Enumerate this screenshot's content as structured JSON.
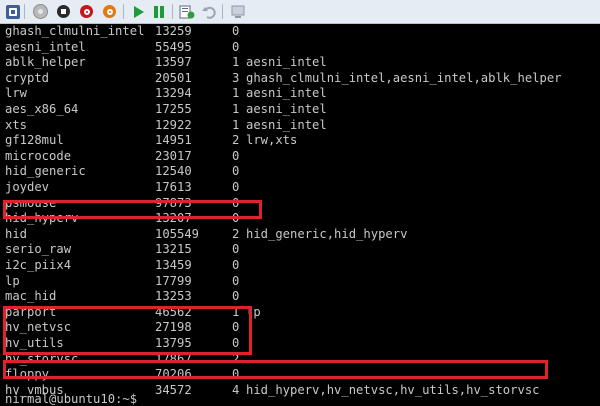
{
  "toolbar": {
    "buttons": [
      {
        "name": "ctrl-alt-del-button",
        "icon": "ctrl-alt-del-icon"
      },
      {
        "name": "start-button",
        "icon": "start-icon"
      },
      {
        "name": "turn-off-button",
        "icon": "turn-off-icon"
      },
      {
        "name": "shut-down-button",
        "icon": "shut-down-icon"
      },
      {
        "name": "power-button",
        "icon": "power-icon"
      },
      {
        "name": "start-vm-button",
        "icon": "play-icon"
      },
      {
        "name": "pause-button",
        "icon": "pause-icon"
      },
      {
        "name": "checkpoint-button",
        "icon": "checkpoint-icon"
      },
      {
        "name": "revert-button",
        "icon": "revert-icon"
      },
      {
        "name": "enhanced-session-button",
        "icon": "enhanced-session-icon"
      }
    ]
  },
  "terminal": {
    "rows": [
      {
        "module": "ghash_clmulni_intel",
        "size": "13259",
        "used": "0",
        "by": ""
      },
      {
        "module": "aesni_intel",
        "size": "55495",
        "used": "0",
        "by": ""
      },
      {
        "module": "ablk_helper",
        "size": "13597",
        "used": "1",
        "by": "aesni_intel"
      },
      {
        "module": "cryptd",
        "size": "20501",
        "used": "3",
        "by": "ghash_clmulni_intel,aesni_intel,ablk_helper"
      },
      {
        "module": "lrw",
        "size": "13294",
        "used": "1",
        "by": "aesni_intel"
      },
      {
        "module": "aes_x86_64",
        "size": "17255",
        "used": "1",
        "by": "aesni_intel"
      },
      {
        "module": "xts",
        "size": "12922",
        "used": "1",
        "by": "aesni_intel"
      },
      {
        "module": "gf128mul",
        "size": "14951",
        "used": "2",
        "by": "lrw,xts"
      },
      {
        "module": "microcode",
        "size": "23017",
        "used": "0",
        "by": ""
      },
      {
        "module": "hid_generic",
        "size": "12540",
        "used": "0",
        "by": ""
      },
      {
        "module": "joydev",
        "size": "17613",
        "used": "0",
        "by": ""
      },
      {
        "module": "psmouse",
        "size": "97873",
        "used": "0",
        "by": ""
      },
      {
        "module": "hid_hyperv",
        "size": "13207",
        "used": "0",
        "by": ""
      },
      {
        "module": "hid",
        "size": "105549",
        "used": "2",
        "by": "hid_generic,hid_hyperv"
      },
      {
        "module": "serio_raw",
        "size": "13215",
        "used": "0",
        "by": ""
      },
      {
        "module": "i2c_piix4",
        "size": "13459",
        "used": "0",
        "by": ""
      },
      {
        "module": "lp",
        "size": "17799",
        "used": "0",
        "by": ""
      },
      {
        "module": "mac_hid",
        "size": "13253",
        "used": "0",
        "by": ""
      },
      {
        "module": "parport",
        "size": "46562",
        "used": "1",
        "by": "lp"
      },
      {
        "module": "hv_netvsc",
        "size": "27198",
        "used": "0",
        "by": ""
      },
      {
        "module": "hv_utils",
        "size": "13795",
        "used": "0",
        "by": ""
      },
      {
        "module": "hv_storvsc",
        "size": "17867",
        "used": "2",
        "by": ""
      },
      {
        "module": "floppy",
        "size": "70206",
        "used": "0",
        "by": ""
      },
      {
        "module": "hv_vmbus",
        "size": "34572",
        "used": "4",
        "by": "hid_hyperv,hv_netvsc,hv_utils,hv_storvsc"
      }
    ],
    "prompt": "nirmal@ubuntu10:~$"
  },
  "colors": {
    "highlight": "#e0232b",
    "terminal_text": "#c8c8c8",
    "terminal_bg": "#000000",
    "toolbar_bg": "#e6ecf3"
  }
}
